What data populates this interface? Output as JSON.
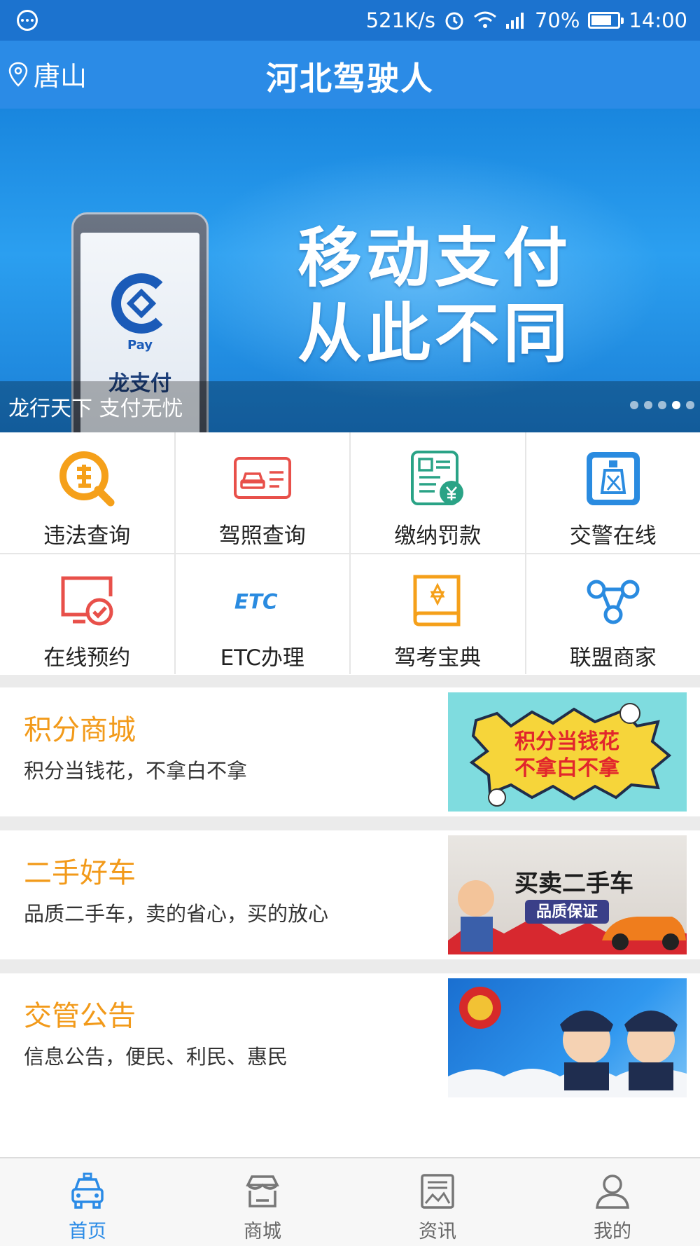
{
  "status_bar": {
    "speed": "521K/s",
    "battery": "70%",
    "time": "14:00"
  },
  "header": {
    "location": "唐山",
    "title": "河北驾驶人"
  },
  "banner": {
    "phone_pay_text": "Pay",
    "phone_brand": "龙支付",
    "headline_line1": "移动支付",
    "headline_line2": "从此不同",
    "caption": "龙行天下 支付无忧",
    "slide_count": 5,
    "active_slide": 4
  },
  "grid": [
    {
      "label": "违法查询",
      "icon": "violation-query-icon",
      "color": "#f5a01a"
    },
    {
      "label": "驾照查询",
      "icon": "license-card-icon",
      "color": "#e8504a"
    },
    {
      "label": "缴纳罚款",
      "icon": "fine-payment-icon",
      "color": "#2aa386"
    },
    {
      "label": "交警在线",
      "icon": "traffic-police-icon",
      "color": "#2a8be0"
    },
    {
      "label": "在线预约",
      "icon": "appointment-monitor-icon",
      "color": "#e8504a"
    },
    {
      "label": "ETC办理",
      "icon": "etc-icon",
      "color": "#2a8be0"
    },
    {
      "label": "驾考宝典",
      "icon": "exam-book-icon",
      "color": "#f5a01a"
    },
    {
      "label": "联盟商家",
      "icon": "alliance-network-icon",
      "color": "#2a8be0"
    }
  ],
  "promos": [
    {
      "title": "积分商城",
      "desc": "积分当钱花，不拿白不拿",
      "img_text": "积分当钱花\n不拿白不拿",
      "img_line1": "积分当钱花",
      "img_line2": "不拿白不拿"
    },
    {
      "title": "二手好车",
      "desc": "品质二手车，卖的省心，买的放心",
      "img_line1": "买卖二手车",
      "img_line2": "品质保证"
    },
    {
      "title": "交管公告",
      "desc": "信息公告，便民、利民、惠民"
    }
  ],
  "tabs": [
    {
      "label": "首页",
      "icon": "car-home-icon",
      "active": true
    },
    {
      "label": "商城",
      "icon": "shop-icon",
      "active": false
    },
    {
      "label": "资讯",
      "icon": "news-icon",
      "active": false
    },
    {
      "label": "我的",
      "icon": "profile-icon",
      "active": false
    }
  ],
  "colors": {
    "primary": "#2b8be6",
    "status_bar": "#1c73cf",
    "accent_orange": "#f29a1a"
  }
}
